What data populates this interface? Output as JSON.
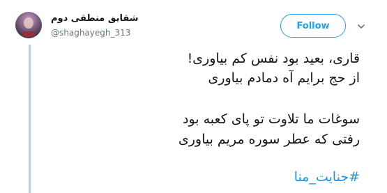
{
  "author": {
    "display_name": "شقایق منطقی دوم",
    "handle": "@shaghayegh_313"
  },
  "follow_button": {
    "label": "Follow"
  },
  "icons": {
    "menu": "chevron-down-icon",
    "avatar": "avatar"
  },
  "colors": {
    "accent": "#1da1f2",
    "hashtag": "#1b95e0",
    "thread_line": "#a8d8f2",
    "text": "#14171a",
    "muted": "#657786"
  },
  "tweet": {
    "lines": [
      "قاری، بعید بود نفس کم بیاوری!",
      "از حج برایم آه دمادم بیاوری",
      "سوغات ما تلاوت تو پای کعبه بود",
      "رفتی که عطر سوره مریم بیاوری"
    ],
    "hashtag": "#جنایت_منا"
  }
}
